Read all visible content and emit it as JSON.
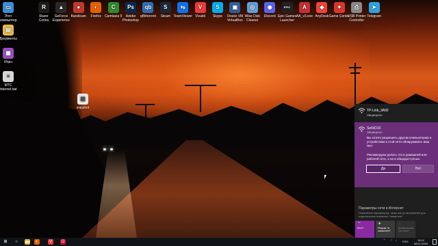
{
  "desktop": {
    "top_icons": [
      {
        "label": "Razer\nCortex",
        "icon": "razer-cortex-icon",
        "color": "#1d1d1d",
        "glyph": "R"
      },
      {
        "label": "GeForce\nExperience",
        "icon": "geforce-icon",
        "color": "#2a2a2a",
        "glyph": "▲"
      },
      {
        "label": "Bandicam",
        "icon": "bandicam-icon",
        "color": "#c0392b",
        "glyph": "●"
      },
      {
        "label": "Firefox",
        "icon": "firefox-icon",
        "color": "#e66000",
        "glyph": "◐"
      },
      {
        "label": "Camtasia 9",
        "icon": "camtasia-icon",
        "color": "#2e8b2e",
        "glyph": "C"
      },
      {
        "label": "Adobe\nPhotoshop",
        "icon": "photoshop-icon",
        "color": "#0c2a4d",
        "glyph": "Ps"
      },
      {
        "label": "qBittorrent",
        "icon": "qbittorrent-icon",
        "color": "#2d6fb8",
        "glyph": "qb"
      },
      {
        "label": "Steam",
        "icon": "steam-icon",
        "color": "#1b2838",
        "glyph": "S"
      },
      {
        "label": "TeamViewer",
        "icon": "teamviewer-icon",
        "color": "#0e72ed",
        "glyph": "⇆"
      },
      {
        "label": "Vivaldi",
        "icon": "vivaldi-icon",
        "color": "#ef3939",
        "glyph": "V"
      },
      {
        "label": "Skype",
        "icon": "skype-icon",
        "color": "#00aff0",
        "glyph": "S"
      },
      {
        "label": "Oracle VM\nVirtualBox",
        "icon": "virtualbox-icon",
        "color": "#2f5e9c",
        "glyph": "▣"
      },
      {
        "label": "Wise Disk\nCleaner",
        "icon": "wise-disk-cleaner-icon",
        "color": "#5fa0d8",
        "glyph": "◎"
      },
      {
        "label": "Discord",
        "icon": "discord-icon",
        "color": "#5865f2",
        "glyph": "◉"
      },
      {
        "label": "Epic Games\nLauncher",
        "icon": "epic-games-icon",
        "color": "#222222",
        "glyph": "EPIC"
      },
      {
        "label": "AA_v3.exe",
        "icon": "ammyy-admin-icon",
        "color": "#c53030",
        "glyph": "A"
      },
      {
        "label": "AnyDesk",
        "icon": "anydesk-icon",
        "color": "#ef443b",
        "glyph": "◆"
      },
      {
        "label": "Game Center",
        "icon": "game-center-icon",
        "color": "#d8362c",
        "glyph": "✦"
      },
      {
        "label": "USB Printer\nController",
        "icon": "usb-printer-icon",
        "color": "#8a8a8a",
        "glyph": "⎙"
      },
      {
        "label": "Telegram",
        "icon": "telegram-icon",
        "color": "#2ca5e0",
        "glyph": "➤"
      }
    ],
    "left_icons": [
      {
        "label": "Этот\nкомпьютер",
        "icon": "this-pc-icon",
        "color": "#3a8fd8",
        "glyph": "▭"
      },
      {
        "label": "Документы",
        "icon": "documents-folder-icon",
        "color": "#e8b84a",
        "glyph": "▤"
      },
      {
        "label": "Игры",
        "icon": "games-folder-icon",
        "color": "#9b4fc4",
        "glyph": "▦"
      },
      {
        "label": "МТС\nInternet.bat",
        "icon": "bat-file-icon",
        "color": "#d8d8d8",
        "glyph": "≡"
      }
    ],
    "floating_icon": {
      "label": "snipshot",
      "icon": "image-file-icon",
      "color": "#e8e8e8",
      "glyph": "▨"
    }
  },
  "network_flyout": {
    "networks": [
      {
        "name": "TP-Link_3A92",
        "status": "Защищено"
      },
      {
        "name": "SeNiO10",
        "status": "Защищено"
      }
    ],
    "prompt": "Вы хотите разрешить другим компьютерам и устройствам в этой сети обнаруживать ваш ПК?",
    "hint": "Рекомендуем делать это в домашней или рабочей сети, а не в общедоступных.",
    "yes_label": "Да",
    "no_label": "Нет",
    "settings_link": "Параметры сети и Интернет",
    "settings_desc": "Изменение параметров, таких как установление для подключения значения \"лимитное\".",
    "quick_actions": [
      {
        "label": "Wi-Fi",
        "icon": "wifi-icon"
      },
      {
        "label": "Режим \"в самолете\"",
        "icon": "airplane-icon"
      },
      {
        "label": "Мобильный хот-спот",
        "icon": "hotspot-icon"
      }
    ],
    "colors": {
      "panel": "#1f1f1f",
      "accent": "#6b2f7a",
      "toggle_on": "#8a2aa0"
    }
  },
  "taskbar": {
    "language": "ENG",
    "time": "19:12",
    "date": "08.07.2020",
    "pinned": [
      {
        "icon": "windows-start-icon",
        "glyph": "⊞",
        "color": "#101418"
      },
      {
        "icon": "search-icon",
        "glyph": "○",
        "color": "#101418"
      },
      {
        "icon": "explorer-folder-icon",
        "glyph": "▬",
        "color": "#e8b84a"
      },
      {
        "icon": "firefox-taskbar-icon",
        "glyph": "◐",
        "color": "#e66000"
      },
      {
        "icon": "vivaldi-taskbar-icon",
        "glyph": "V",
        "color": "#ef3939"
      },
      {
        "icon": "opera-taskbar-icon",
        "glyph": "O",
        "color": "#c8102e"
      }
    ]
  }
}
